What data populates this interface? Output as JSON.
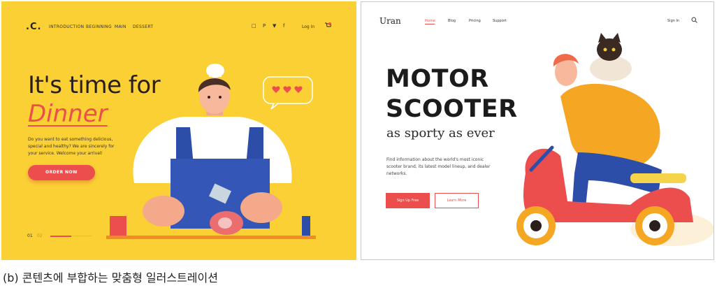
{
  "left": {
    "logo": ".C.",
    "nav": [
      "INTRODUCTION",
      "BEGINNING",
      "MAIN",
      "DESSERT"
    ],
    "social": [
      "□",
      "P",
      "▼",
      "f"
    ],
    "login": "Log In",
    "cart_count": "1",
    "headline_line1": "It's time for",
    "headline_line2": "Dinner",
    "description": "Do you want to eat something delicious, special and healthy? We are sincerely for your service. Welcome your arrival!",
    "cta": "ORDER NOW",
    "page_current": "01",
    "page_next": "02",
    "colors": {
      "background": "#fbd035",
      "accent": "#ec4d4d"
    }
  },
  "right": {
    "logo": "Uran",
    "nav": [
      "Home",
      "Blog",
      "Pricing",
      "Support"
    ],
    "active_nav": "Home",
    "signin": "Sign In",
    "headline_line1": "MOTOR",
    "headline_line2": "SCOOTER",
    "subtitle": "as sporty as ever",
    "description": "Find information about the world's most iconic scooter brand, its latest model lineup, and dealer networks.",
    "primary_button": "Sign Up Free",
    "secondary_button": "Learn More",
    "colors": {
      "accent": "#ec4d4d"
    }
  },
  "caption": "(b) 콘텐츠에 부합하는 맞춤형 일러스트레이션"
}
